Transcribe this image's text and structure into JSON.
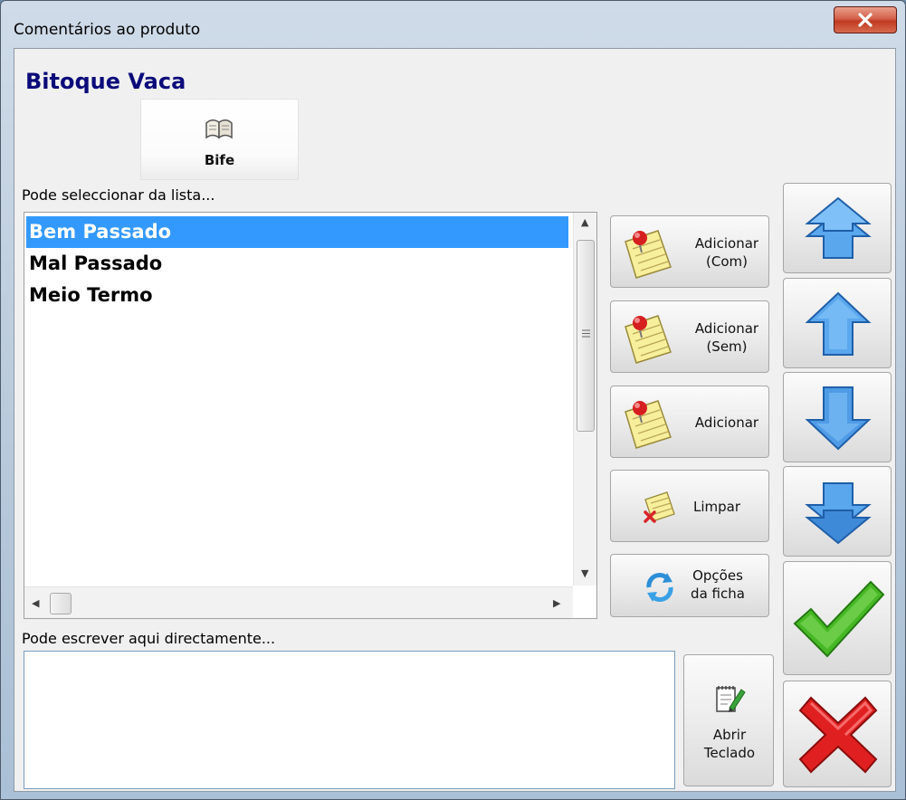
{
  "window": {
    "title": "Comentários ao produto"
  },
  "product": {
    "name": "Bitoque Vaca"
  },
  "category_button": {
    "label": "Bife"
  },
  "list": {
    "caption": "Pode seleccionar da lista...",
    "items": [
      "Bem Passado",
      "Mal Passado",
      "Meio Termo"
    ],
    "selected_index": 0
  },
  "free_text": {
    "caption": "Pode escrever aqui directamente...",
    "value": ""
  },
  "actions": {
    "add_with": [
      "Adicionar",
      "(Com)"
    ],
    "add_without": [
      "Adicionar",
      "(Sem)"
    ],
    "add": "Adicionar",
    "clear": "Limpar",
    "sheet_options": [
      "Opções",
      "da ficha"
    ],
    "open_keyboard": [
      "Abrir",
      "Teclado"
    ]
  },
  "icons": {
    "close": "close-icon",
    "book": "book-icon",
    "note": "pinned-note-icon",
    "clear": "clear-note-icon",
    "refresh": "refresh-icon",
    "keyboard": "notepad-pencil-icon",
    "first": "double-up-arrow-icon",
    "up": "up-arrow-icon",
    "down": "down-arrow-icon",
    "last": "double-down-arrow-icon",
    "ok": "check-icon",
    "cancel": "cross-icon"
  },
  "colors": {
    "selection": "#3399ff",
    "title": "#0b0b7a",
    "arrow": "#2f7fd6",
    "check": "#3fb21e",
    "cross": "#d01010"
  }
}
